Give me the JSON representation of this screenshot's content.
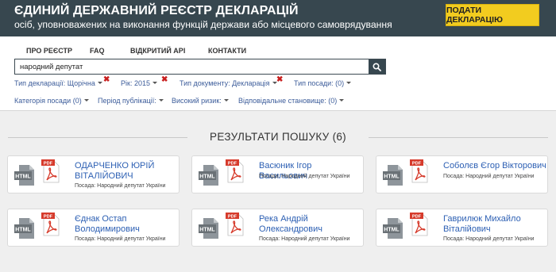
{
  "header": {
    "title": "ЄДИНИЙ ДЕРЖАВНИЙ РЕЄСТР ДЕКЛАРАЦІЙ",
    "subtitle": "осіб, уповноважених на виконання функцій держави або місцевого самоврядування",
    "submit_button": "ПОДАТИ ДЕКЛАРАЦІЮ"
  },
  "nav": {
    "items": [
      "ПРО РЕЄСТР",
      "FAQ",
      "ВІДКРИТИЙ API",
      "КОНТАКТИ"
    ]
  },
  "search": {
    "value": "народний депутат"
  },
  "filters": {
    "row1": [
      "Тип декларації: Щорічна",
      "Рік: 2015",
      "Тип документу: Декларація",
      "Тип посади: (0)"
    ],
    "row2": [
      "Категорія посади (0)",
      "Період публікації:",
      "Високий ризик:",
      "Відповідальне становище: (0)"
    ],
    "remove_mark": "✖"
  },
  "results": {
    "title": "РЕЗУЛЬТАТИ ПОШУКУ (6)",
    "cards": [
      {
        "name": "ОДАРЧЕНКО ЮРІЙ ВІТАЛІЙОВИЧ",
        "position": "Посада: Народний депутат України"
      },
      {
        "name": "Васюник Ігор Васильович",
        "position": "Посада: Народний депутат України"
      },
      {
        "name": "Соболєв Єгор Вікторович",
        "position": "Посада: Народний депутат України"
      },
      {
        "name": "Єднак Остап Володимирович",
        "position": "Посада: Народний депутат України"
      },
      {
        "name": "Река Андрій Олександрович",
        "position": "Посада: Народний депутат України"
      },
      {
        "name": "Гаврилюк Михайло Віталійович",
        "position": "Посада: Народний депутат України"
      }
    ]
  },
  "icons": {
    "html_label": "HTML",
    "pdf_label": "PDF"
  },
  "colors": {
    "header_bg": "#37474f",
    "accent_button": "#f2cc1f",
    "link": "#2c5fb3",
    "pdf_red": "#d63b2c",
    "remove_red": "#c81d1d"
  }
}
